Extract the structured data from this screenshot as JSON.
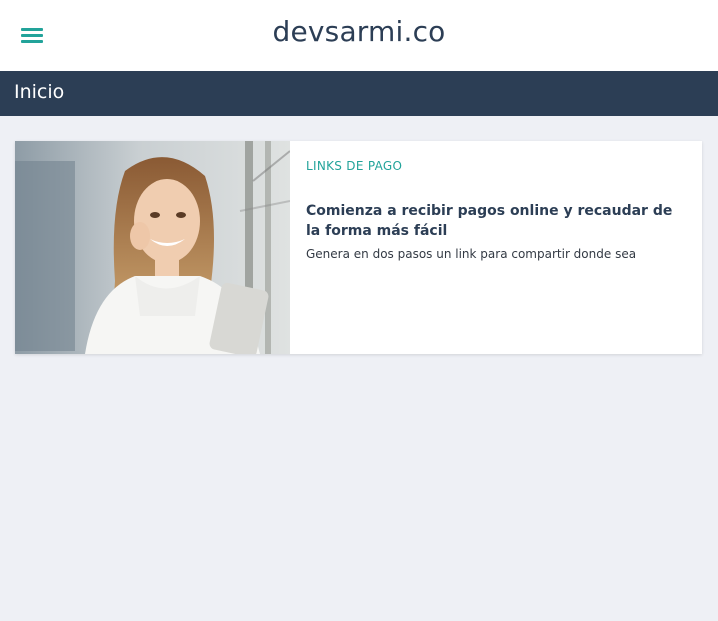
{
  "header": {
    "logo_text": "devsarmi.co",
    "menu_icon": "hamburger-menu-icon",
    "accent_color": "#22a39a"
  },
  "section": {
    "title": "Inicio",
    "bar_color": "#2c3e55"
  },
  "card": {
    "category": "LINKS DE PAGO",
    "title": "Comienza a recibir pagos online y recaudar de la forma más fácil",
    "description": "Genera en dos pasos un link para compartir donde sea"
  }
}
